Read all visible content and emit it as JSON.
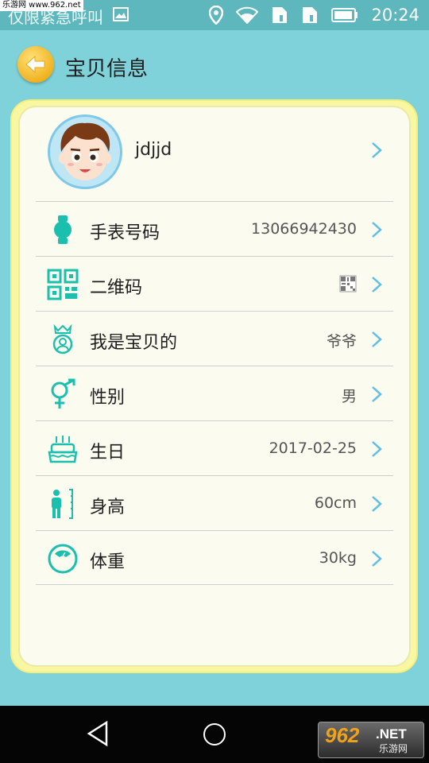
{
  "status_bar": {
    "left_text": "仅限紧急呼叫",
    "time": "20:24",
    "watermark": "乐游网 www.962.net"
  },
  "header": {
    "title": "宝贝信息"
  },
  "profile": {
    "name": "jdjjd"
  },
  "rows": [
    {
      "icon": "watch-icon",
      "label": "手表号码",
      "value": "13066942430"
    },
    {
      "icon": "qrcode-icon",
      "label": "二维码",
      "value": ""
    },
    {
      "icon": "baby-relation-icon",
      "label": "我是宝贝的",
      "value": "爷爷"
    },
    {
      "icon": "gender-icon",
      "label": "性别",
      "value": "男"
    },
    {
      "icon": "birthday-cake-icon",
      "label": "生日",
      "value": "2017-02-25"
    },
    {
      "icon": "height-icon",
      "label": "身高",
      "value": "60cm"
    },
    {
      "icon": "weight-scale-icon",
      "label": "体重",
      "value": "30kg"
    }
  ],
  "brand": {
    "logo_big": "962",
    "logo_net": ".NET",
    "logo_cn": "乐游网"
  },
  "colors": {
    "accent": "#1bbfae",
    "background": "#7fd2d9",
    "card_border": "#f9f7a2"
  }
}
